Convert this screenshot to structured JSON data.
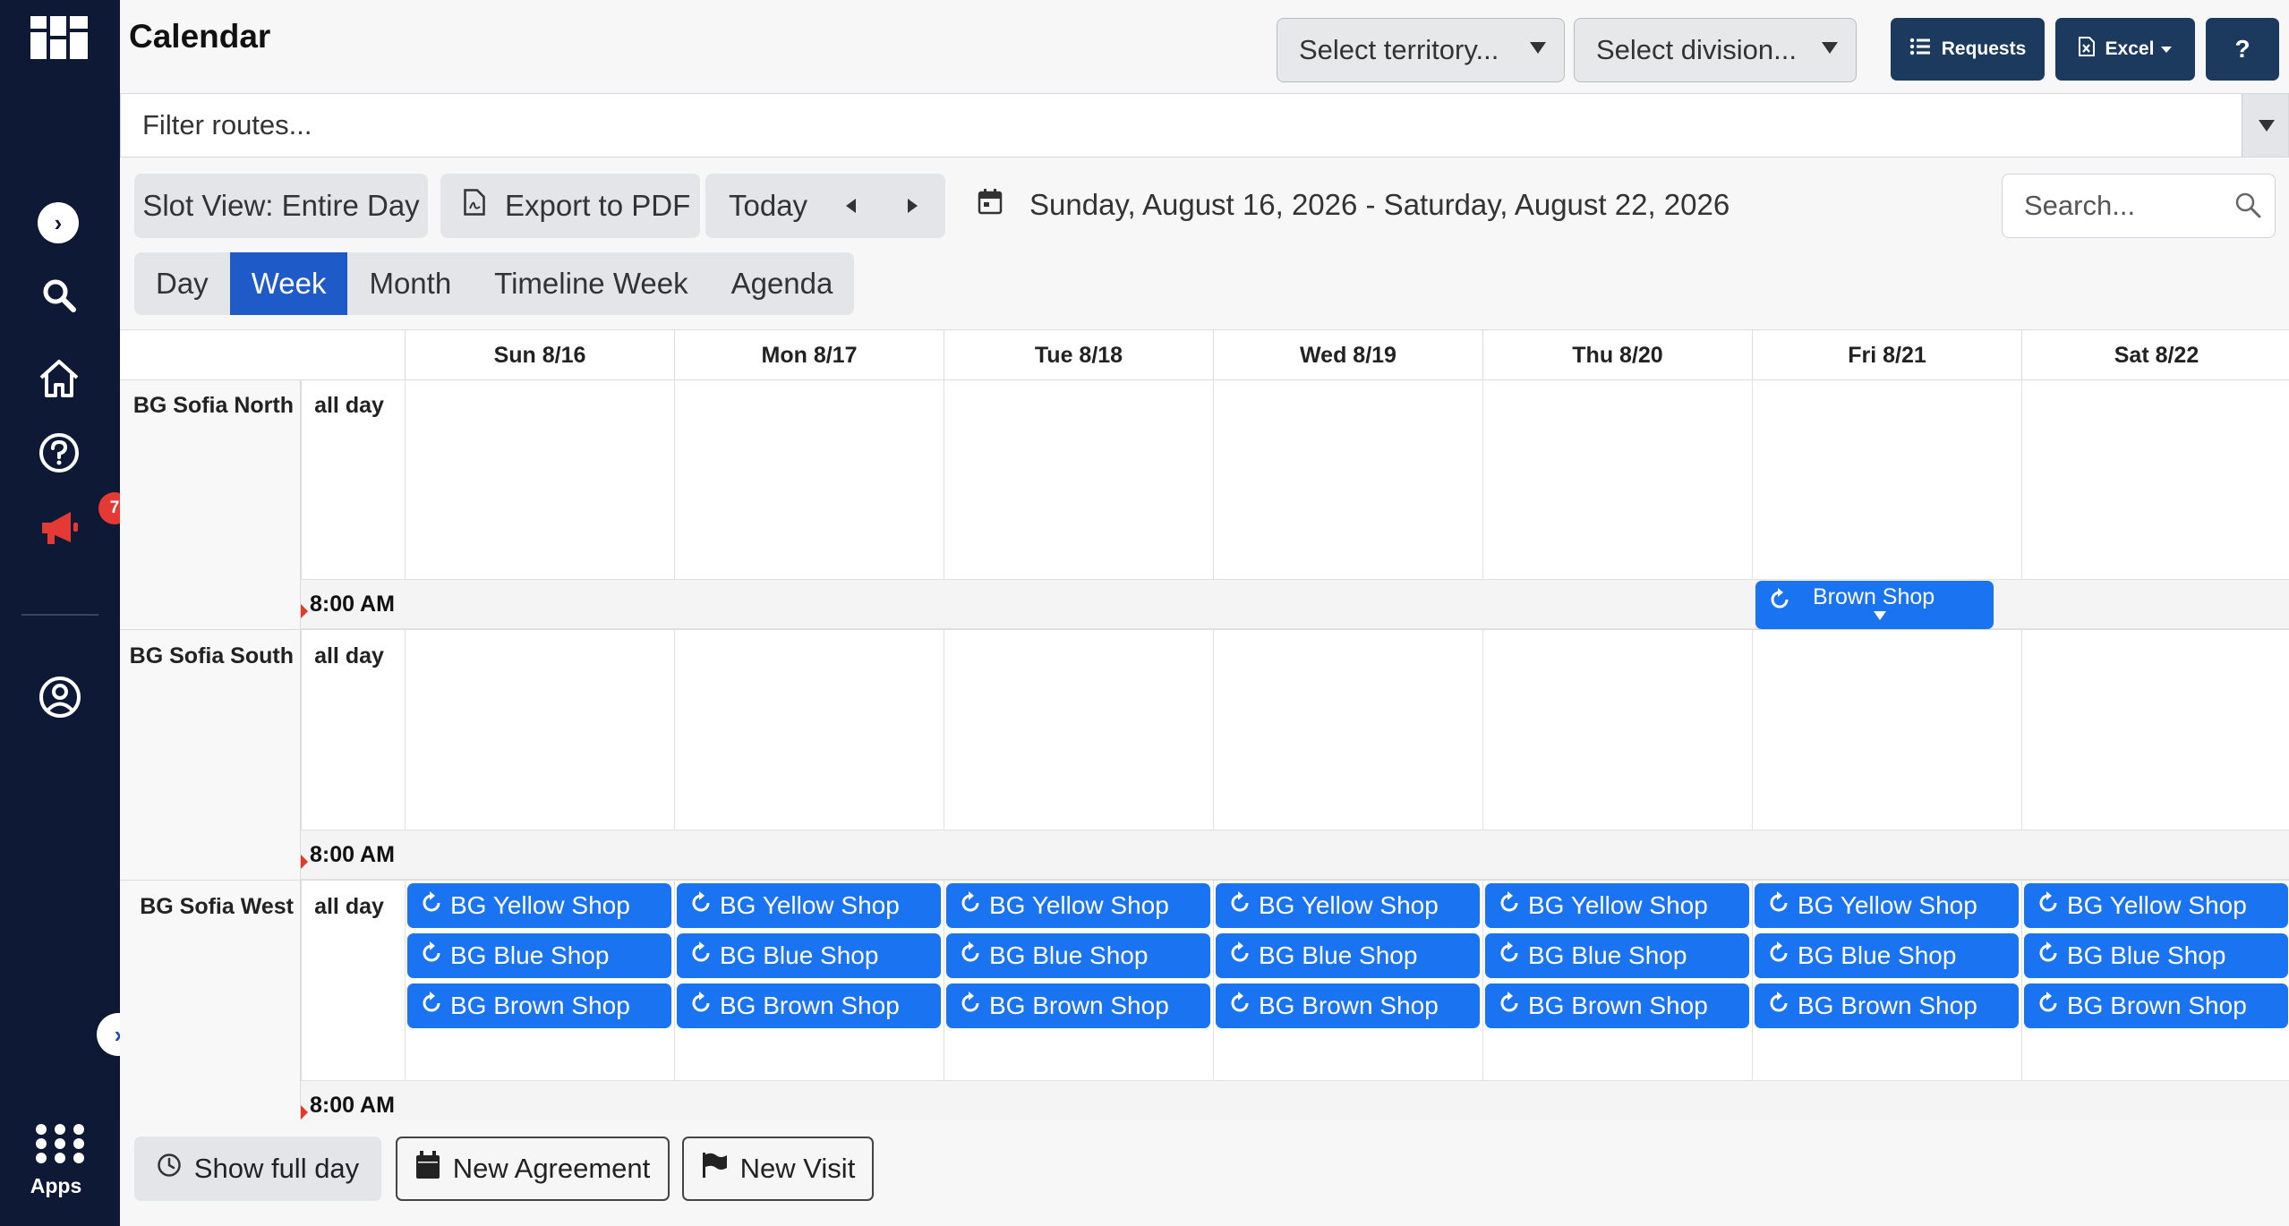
{
  "app": {
    "title": "Calendar"
  },
  "sidebar": {
    "badge_count": "7",
    "apps_label": "Apps",
    "icons": [
      "grid-logo-icon",
      "chevron-right-icon",
      "search-icon",
      "home-icon",
      "help-circle-icon",
      "megaphone-icon",
      "user-circle-icon",
      "apps-grid-icon"
    ]
  },
  "header": {
    "territory_placeholder": "Select territory...",
    "division_placeholder": "Select division...",
    "requests_label": "Requests",
    "excel_label": "Excel",
    "help_label": "?"
  },
  "filter": {
    "placeholder": "Filter routes..."
  },
  "toolbar": {
    "slot_view_label": "Slot View: Entire Day",
    "export_pdf_label": "Export to PDF",
    "today_label": "Today",
    "date_range": "Sunday, August 16, 2026 - Saturday, August 22, 2026",
    "search_placeholder": "Search..."
  },
  "views": {
    "tabs": [
      "Day",
      "Week",
      "Month",
      "Timeline Week",
      "Agenda"
    ],
    "active": "Week"
  },
  "calendar": {
    "days": [
      "Sun 8/16",
      "Mon 8/17",
      "Tue 8/18",
      "Wed 8/19",
      "Thu 8/20",
      "Fri 8/21",
      "Sat 8/22"
    ],
    "all_day_label": "all day",
    "time_label": "8:00 AM",
    "groups": [
      {
        "name": "BG Sofia North",
        "timed_events": [
          {
            "day": "Fri 8/21",
            "title": "Brown Shop",
            "recurring": true
          }
        ],
        "allday_events": []
      },
      {
        "name": "BG Sofia South",
        "timed_events": [],
        "allday_events": []
      },
      {
        "name": "BG Sofia West",
        "timed_events": [],
        "allday_events": [
          {
            "title": "BG Yellow Shop",
            "recurring": true,
            "days": [
              "Sun 8/16",
              "Mon 8/17",
              "Tue 8/18",
              "Wed 8/19",
              "Thu 8/20",
              "Fri 8/21",
              "Sat 8/22"
            ]
          },
          {
            "title": "BG Blue Shop",
            "recurring": true,
            "days": [
              "Sun 8/16",
              "Mon 8/17",
              "Tue 8/18",
              "Wed 8/19",
              "Thu 8/20",
              "Fri 8/21",
              "Sat 8/22"
            ]
          },
          {
            "title": "BG Brown Shop",
            "recurring": true,
            "days": [
              "Sun 8/16",
              "Mon 8/17",
              "Tue 8/18",
              "Wed 8/19",
              "Thu 8/20",
              "Fri 8/21",
              "Sat 8/22"
            ]
          }
        ]
      }
    ]
  },
  "footer": {
    "show_full_day_label": "Show full day",
    "new_agreement_label": "New Agreement",
    "new_visit_label": "New Visit"
  },
  "colors": {
    "sidebar_bg": "#0e1a35",
    "accent": "#1f5ac9",
    "event_bg": "#1a73f0",
    "dark_button": "#1b3a5e",
    "badge": "#e53935"
  }
}
